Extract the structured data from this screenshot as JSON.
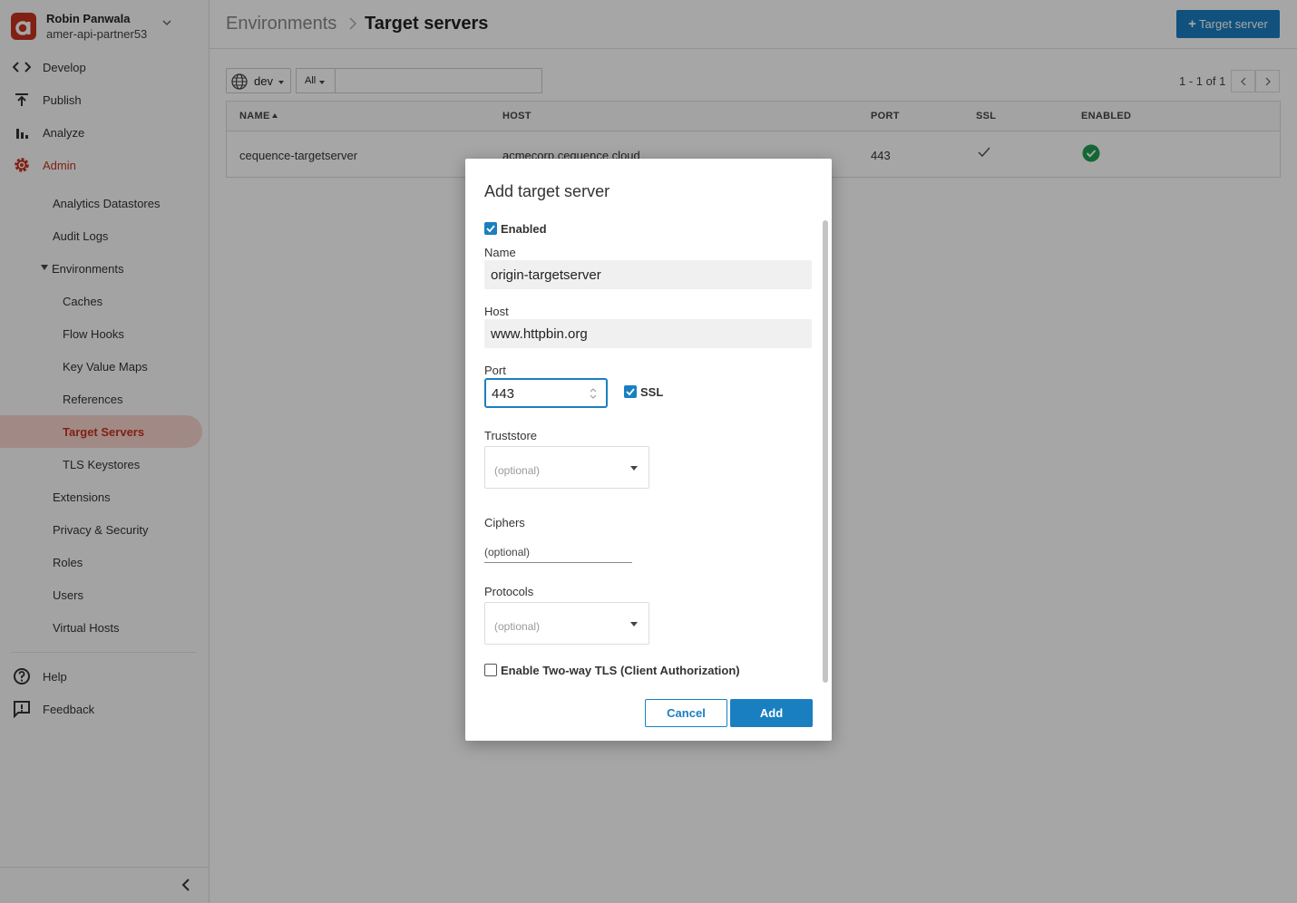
{
  "user": {
    "name": "Robin Panwala",
    "org": "amer-api-partner53"
  },
  "nav": {
    "top": [
      {
        "label": "Develop",
        "icon": "code-icon"
      },
      {
        "label": "Publish",
        "icon": "publish-icon"
      },
      {
        "label": "Analyze",
        "icon": "bar-chart-icon"
      },
      {
        "label": "Admin",
        "icon": "gear-icon",
        "active": true
      }
    ],
    "admin_items": {
      "analytics_datastores": "Analytics Datastores",
      "audit_logs": "Audit Logs",
      "environments": "Environments",
      "caches": "Caches",
      "flow_hooks": "Flow Hooks",
      "key_value_maps": "Key Value Maps",
      "references": "References",
      "target_servers": "Target Servers",
      "tls_keystores": "TLS Keystores",
      "extensions": "Extensions",
      "privacy_security": "Privacy & Security",
      "roles": "Roles",
      "users": "Users",
      "virtual_hosts": "Virtual Hosts"
    },
    "bottom": [
      {
        "label": "Help",
        "icon": "help-icon"
      },
      {
        "label": "Feedback",
        "icon": "feedback-icon"
      }
    ]
  },
  "header": {
    "breadcrumb_parent": "Environments",
    "title": "Target servers",
    "add_button_label": "Target server"
  },
  "toolbar": {
    "env_value": "dev",
    "filter_value": "All",
    "search_value": "",
    "pager_text": "1 - 1 of 1"
  },
  "table": {
    "columns": [
      "NAME",
      "HOST",
      "PORT",
      "SSL",
      "ENABLED"
    ],
    "rows": [
      {
        "name": "cequence-targetserver",
        "host": "acmecorp.cequence.cloud",
        "port": "443",
        "ssl": true,
        "enabled": true
      }
    ]
  },
  "modal": {
    "title": "Add target server",
    "enabled_label": "Enabled",
    "enabled_checked": true,
    "name_label": "Name",
    "name_value": "origin-targetserver",
    "host_label": "Host",
    "host_value": "www.httpbin.org",
    "port_label": "Port",
    "port_value": "443",
    "ssl_label": "SSL",
    "ssl_checked": true,
    "truststore_label": "Truststore",
    "truststore_placeholder": "(optional)",
    "ciphers_label": "Ciphers",
    "ciphers_placeholder": "(optional)",
    "protocols_label": "Protocols",
    "protocols_placeholder": "(optional)",
    "two_way_tls_label": "Enable Two-way TLS (Client Authorization)",
    "two_way_tls_checked": false,
    "cancel_label": "Cancel",
    "add_label": "Add"
  },
  "colors": {
    "accent": "#1a7fc1",
    "brand": "#c5331f",
    "success": "#1e9e50"
  }
}
